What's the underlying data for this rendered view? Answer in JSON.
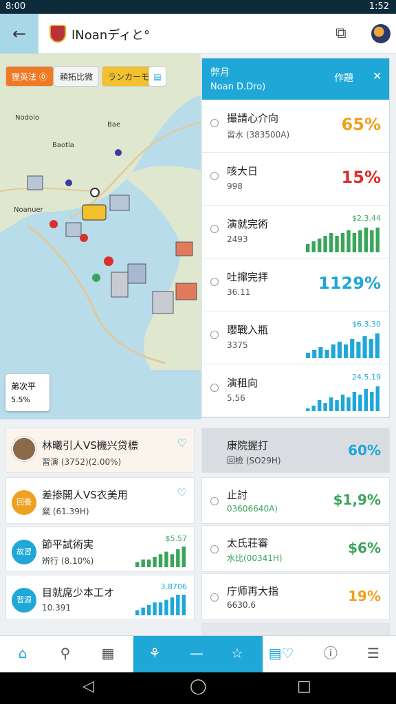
{
  "status": {
    "time": "8:00",
    "clock": "1:52"
  },
  "appbar": {
    "title": "INoanディと°"
  },
  "map": {
    "chips": [
      "狸英法 ⓪",
      "頼拓比微",
      "ランカーモ"
    ],
    "labels": [
      "Nodoio",
      "Bae",
      "Baotla",
      "Noanuer"
    ],
    "card": {
      "title": "弟次平",
      "value": "5.5%"
    }
  },
  "panel": {
    "title": "弊月",
    "subtitle": "Noan D.Dro)",
    "right_label": "作題",
    "rows": [
      {
        "name": "撮請心介向",
        "sub": "習水 (383500A)",
        "pct": "65%",
        "color": "#f0a020",
        "spark": null
      },
      {
        "name": "咳大日",
        "sub": "998",
        "pct": "15%",
        "color": "#d9302c",
        "spark": null
      },
      {
        "name": "演就完術",
        "sub": "2493",
        "pct": null,
        "color": "#3aa55a",
        "spark": {
          "label": "$2.3.44",
          "values": [
            3,
            4,
            5,
            6,
            7,
            6,
            7,
            8,
            7,
            8,
            9,
            8,
            9
          ]
        }
      },
      {
        "name": "吐撺完拝",
        "sub": "36.11",
        "pct": "1129%",
        "color": "#1fa7d8",
        "spark": null
      },
      {
        "name": "瓔戰入瓶",
        "sub": "3375",
        "pct": null,
        "color": "#1fa7d8",
        "spark": {
          "label": "$6.3.30",
          "values": [
            2,
            3,
            4,
            3,
            5,
            6,
            5,
            7,
            6,
            8,
            7,
            9
          ]
        }
      },
      {
        "name": "演租向",
        "sub": "5.56",
        "pct": null,
        "color": "#1fa7d8",
        "spark": {
          "label": "24.5.19",
          "values": [
            1,
            2,
            4,
            3,
            5,
            4,
            6,
            5,
            7,
            6,
            8,
            7,
            9
          ]
        }
      }
    ]
  },
  "left_cards": [
    {
      "name": "林曦引人VS機兴贷標",
      "sub": "習演 (3752)(2.00%)",
      "badge": "",
      "badge_color": "",
      "spark": null
    },
    {
      "name": "差掺開人VS衣美用",
      "sub": "粲 (61.39H)",
      "badge": "回畳",
      "badge_color": "#f0a020",
      "spark": null
    },
    {
      "name": "節平試術実",
      "sub": "辨行 (8.10%)",
      "badge": "故習",
      "badge_color": "#1fa7d8",
      "spark": {
        "label": "$5.57",
        "color": "#3aa55a",
        "values": [
          2,
          3,
          3,
          4,
          5,
          6,
          5,
          7,
          8
        ]
      }
    },
    {
      "name": "目就席少本工オ",
      "sub": "10.391",
      "badge": "習源",
      "badge_color": "#1fa7d8",
      "spark": {
        "label": "3.8706",
        "color": "#1fa7d8",
        "values": [
          2,
          3,
          4,
          5,
          5,
          6,
          7,
          8,
          8
        ]
      }
    }
  ],
  "right_cards": [
    {
      "name": "康院握打",
      "sub": "回檢 (SO29H)",
      "pct": "60%",
      "color": "#1fa7d8",
      "sub_color": "#444",
      "shaded": true
    },
    {
      "name": "止討",
      "sub": "03606640A)",
      "pct": "$1,9%",
      "color": "#3aa55a",
      "sub_color": "#3aa55a",
      "shaded": false
    },
    {
      "name": "太氏荘審",
      "sub": "水比(00341H)",
      "pct": "$6%",
      "color": "#3aa55a",
      "sub_color": "#3aa55a",
      "shaded": false
    },
    {
      "name": "庁师再大指",
      "sub": "6630.6",
      "pct": "19%",
      "color": "#f0a020",
      "sub_color": "#444",
      "shaded": false
    }
  ]
}
